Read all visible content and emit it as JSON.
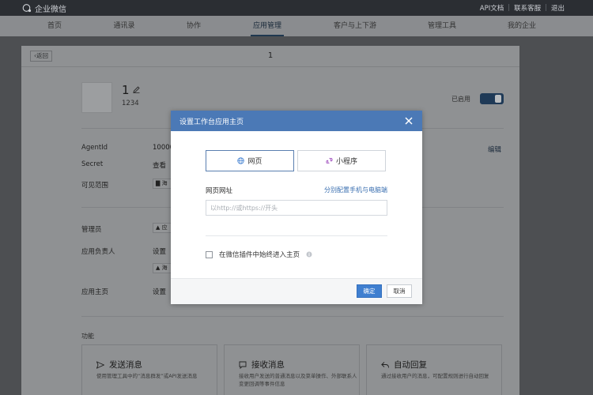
{
  "topbar": {
    "brand": "企业微信",
    "links": [
      "API文档",
      "联系客服",
      "退出"
    ]
  },
  "nav": {
    "items": [
      "首页",
      "通讯录",
      "协作",
      "应用管理",
      "客户与上下游",
      "管理工具",
      "我的企业"
    ],
    "active": "应用管理"
  },
  "page": {
    "back_label": "返回",
    "title": "1",
    "app_name": "1",
    "app_id": "1234",
    "enabled_label": "已启用",
    "edit_label": "编辑",
    "rows": {
      "agentid_label": "AgentId",
      "agentid_value": "10000",
      "secret_label": "Secret",
      "secret_value": "查看",
      "visible_label": "可见范围",
      "visible_chip": "海",
      "admin_label": "管理员",
      "admin_chip": "应",
      "owner_label": "应用负责人",
      "owner_value": "设置",
      "owner_chip": "海",
      "home_label": "应用主页",
      "home_value": "设置"
    },
    "functions_label": "功能",
    "functions": [
      {
        "icon": "send-icon",
        "title": "发送消息",
        "desc": "使用管理工具中的“消息群发”或API发送消息"
      },
      {
        "icon": "message-icon",
        "title": "接收消息",
        "desc": "接收用户发送的普通消息以及菜单操作、外部联系人变更回调等事件信息"
      },
      {
        "icon": "reply-icon",
        "title": "自动回复",
        "desc": "通过接收用户的消息，可配置规则进行自动回复"
      }
    ]
  },
  "modal": {
    "title": "设置工作台应用主页",
    "tabs": [
      "网页",
      "小程序"
    ],
    "active_tab": "网页",
    "url_label": "网页网址",
    "url_link": "分别配置手机与电脑端",
    "url_placeholder": "以http://或https://开头",
    "url_value": "",
    "checkbox_label": "在微信插件中始终进入主页",
    "checkbox_checked": false,
    "ok_label": "确定",
    "cancel_label": "取消"
  },
  "colors": {
    "modal_header": "#4b79b6",
    "primary_button": "#3f7fd0",
    "link": "#3a6fb0",
    "topbar": "#2b2e33"
  }
}
